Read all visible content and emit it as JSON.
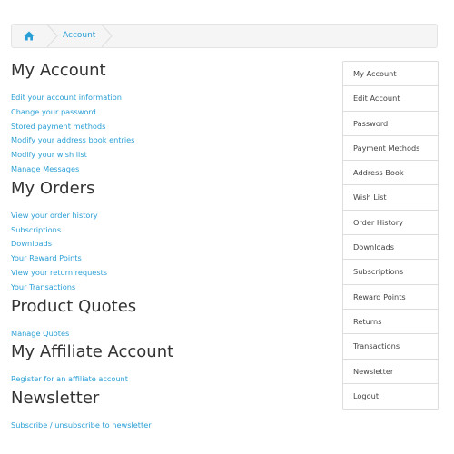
{
  "breadcrumb": {
    "home_icon": "home-icon",
    "items": [
      "Account"
    ]
  },
  "sections": [
    {
      "title": "My Account",
      "links": [
        "Edit your account information",
        "Change your password",
        "Stored payment methods",
        "Modify your address book entries",
        "Modify your wish list",
        "Manage Messages"
      ]
    },
    {
      "title": "My Orders",
      "links": [
        "View your order history",
        "Subscriptions",
        "Downloads",
        "Your Reward Points",
        "View your return requests",
        "Your Transactions"
      ]
    },
    {
      "title": "Product Quotes",
      "links": [
        "Manage Quotes"
      ]
    },
    {
      "title": "My Affiliate Account",
      "links": [
        "Register for an affiliate account"
      ]
    },
    {
      "title": "Newsletter",
      "links": [
        "Subscribe / unsubscribe to newsletter"
      ]
    }
  ],
  "sidebar": {
    "items": [
      "My Account",
      "Edit Account",
      "Password",
      "Payment Methods",
      "Address Book",
      "Wish List",
      "Order History",
      "Downloads",
      "Subscriptions",
      "Reward Points",
      "Returns",
      "Transactions",
      "Newsletter",
      "Logout"
    ]
  },
  "colors": {
    "link": "#2a9fd6",
    "heading": "#333333",
    "border": "#dddddd"
  }
}
